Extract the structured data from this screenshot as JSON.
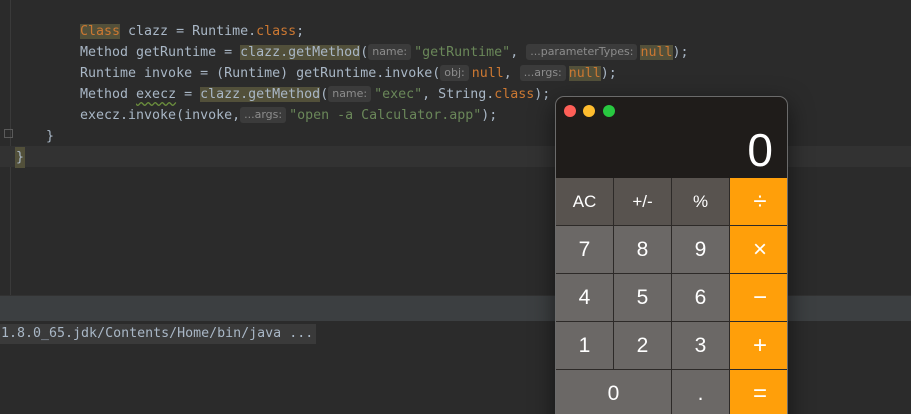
{
  "editor": {
    "lines": {
      "l1": {
        "a": "Class",
        "b": " clazz = Runtime.",
        "c": "class",
        "d": ";"
      },
      "l2": {
        "a": "Method getRuntime = ",
        "b": "clazz.getMethod",
        "c": "(",
        "h1": "name:",
        "s1": "\"getRuntime\"",
        "c2": ", ",
        "h2": "...parameterTypes:",
        "n": "null",
        "e": ");"
      },
      "l3": {
        "a": "Runtime invoke = (Runtime) getRuntime.invoke(",
        "h1": "obj:",
        "n1": "null",
        "c": ", ",
        "h2": "...args:",
        "n2": "null",
        "e": ");"
      },
      "l4": {
        "a": "Method ",
        "w": "execz",
        "b": " = ",
        "m": "clazz.getMethod",
        "c": "(",
        "h1": "name:",
        "s1": "\"exec\"",
        "d": ", String.",
        "k": "class",
        "e": ");"
      },
      "l5": {
        "a": "execz.invoke(invoke,",
        "h1": "...args:",
        "s1": "\"open -a Calculator.app\"",
        "e": ");"
      }
    },
    "close_brace_inner": "}",
    "close_brace_outer": "}"
  },
  "console": {
    "line": "1.8.0_65.jdk/Contents/Home/bin/java ..."
  },
  "calculator": {
    "display": "0",
    "keys": [
      "AC",
      "+/-",
      "%",
      "÷",
      "7",
      "8",
      "9",
      "×",
      "4",
      "5",
      "6",
      "−",
      "1",
      "2",
      "3",
      "+",
      "0",
      ".",
      "="
    ],
    "colors": {
      "operator": "#ff9f0a",
      "function": "#58534f",
      "digit": "#6b6866"
    }
  }
}
